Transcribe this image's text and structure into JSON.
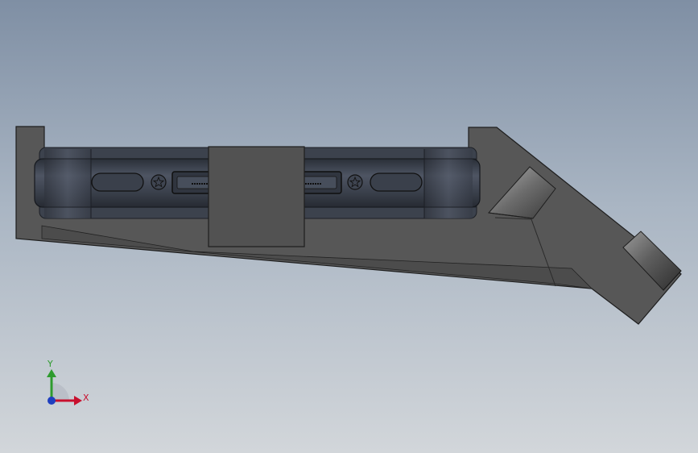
{
  "viewport": {
    "background_top": "#7f8fa4",
    "background_bottom": "#d2d6da"
  },
  "model": {
    "body_color": "#555555",
    "edge_color": "#1f1f1f",
    "phone_color": "#3d4350",
    "clip_color": "#4f4f4f",
    "cylinder_color": "#6a6a6a",
    "screw_icon": "star-screw-icon",
    "port_icon": "usb-c-port-icon"
  },
  "triad": {
    "x_label": "X",
    "y_label": "Y",
    "x_color": "#c8102e",
    "y_color": "#2e9b2e",
    "z_color": "#1f3fbf"
  }
}
